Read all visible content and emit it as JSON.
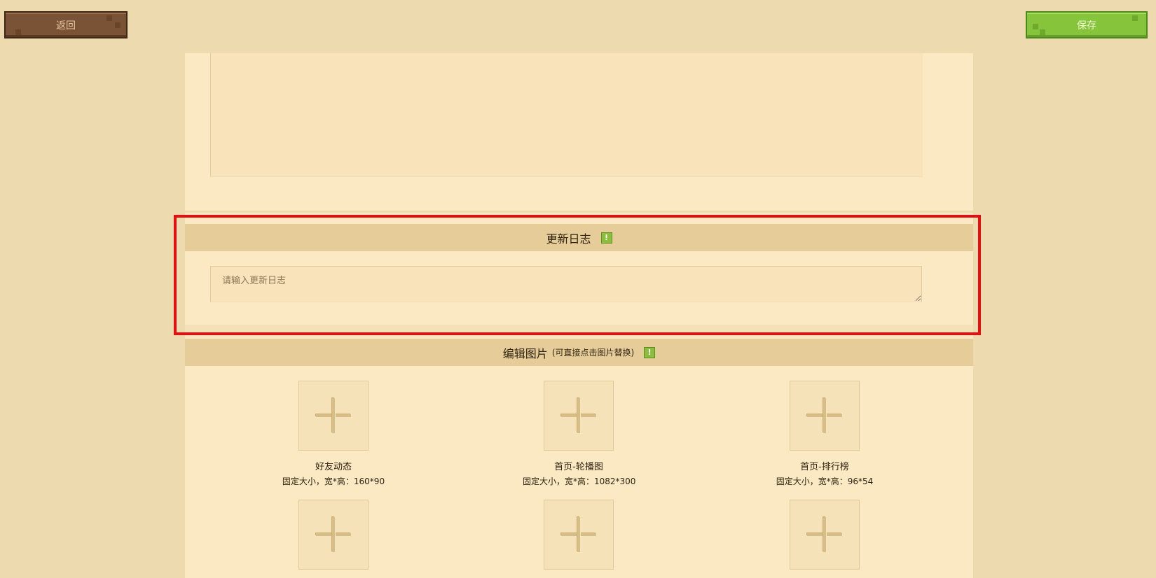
{
  "toolbar": {
    "back_label": "返回",
    "save_label": "保存"
  },
  "update_log": {
    "title": "更新日志",
    "warn_icon": "!",
    "placeholder": "请输入更新日志"
  },
  "edit_images": {
    "title": "编辑图片",
    "subtitle": "(可直接点击图片替换)",
    "warn_icon": "!",
    "slots": [
      {
        "name": "好友动态",
        "spec": "固定大小，宽*高：160*90"
      },
      {
        "name": "首页-轮播图",
        "spec": "固定大小，宽*高：1082*300"
      },
      {
        "name": "首页-排行榜",
        "spec": "固定大小，宽*高：96*54"
      }
    ]
  },
  "colors": {
    "page_bg": "#eedaaf",
    "panel_bg": "#fbe9c3",
    "header_bg": "#e5cc99",
    "back_button": "#7a5236",
    "save_button": "#86c43c",
    "highlight": "#e50f0f"
  }
}
